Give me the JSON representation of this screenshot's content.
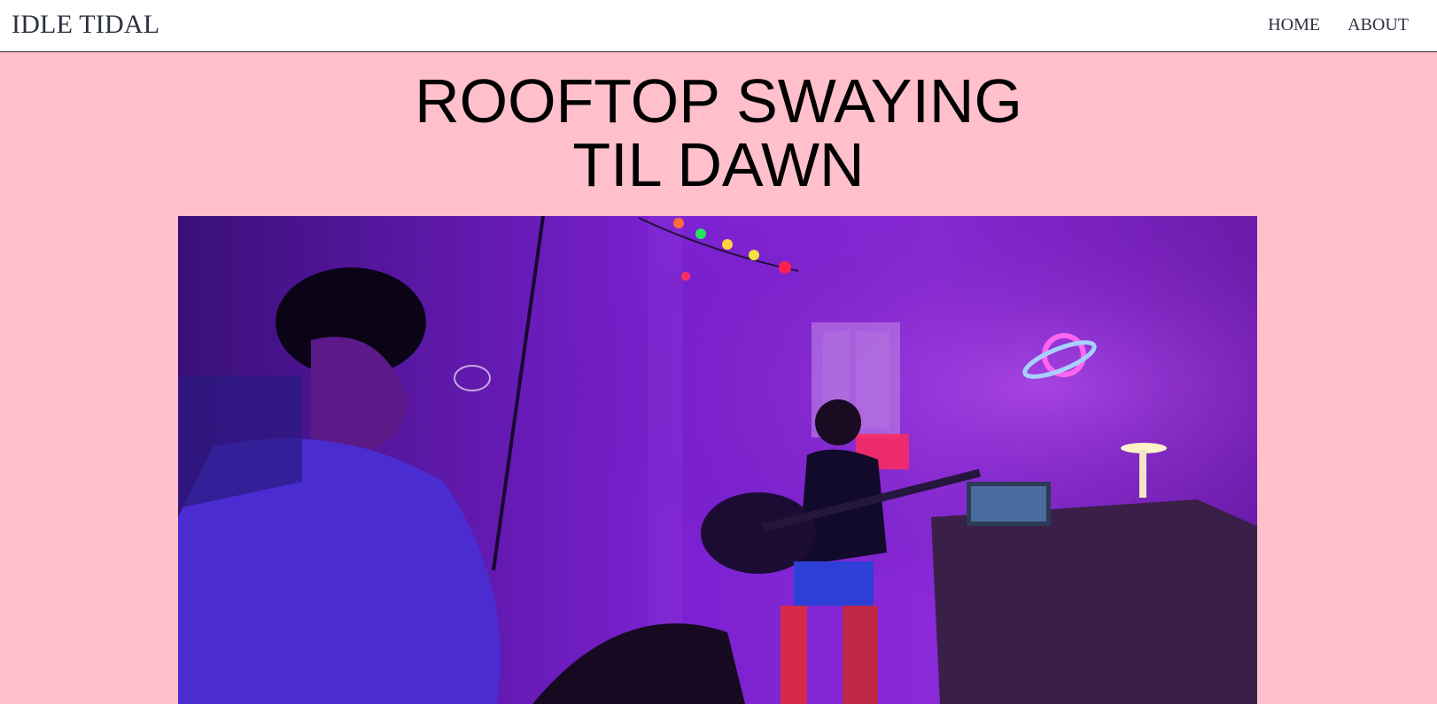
{
  "header": {
    "brand": "IDLE TIDAL",
    "nav": [
      {
        "label": "HOME"
      },
      {
        "label": "ABOUT"
      }
    ]
  },
  "main": {
    "title_lines": [
      "ROOFTOP SWAYING",
      "TIL DAWN"
    ]
  },
  "colors": {
    "page_background": "#ffc0cb",
    "header_background": "#ffffff",
    "text": "#2b3140",
    "title": "#000000"
  },
  "photo": {
    "alt": "Two people jamming in a purple neon-lit room, one playing acoustic guitar"
  }
}
